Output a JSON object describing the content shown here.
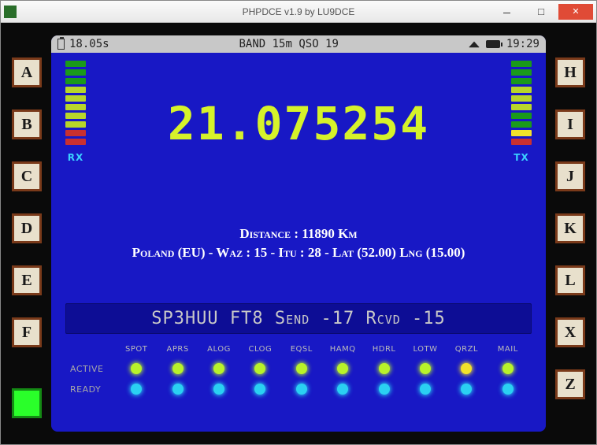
{
  "window": {
    "title": "PHPDCE v1.9 by LU9DCE"
  },
  "left_buttons": [
    "A",
    "B",
    "C",
    "D",
    "E",
    "F"
  ],
  "right_buttons": [
    "H",
    "I",
    "J",
    "K",
    "L",
    "X",
    "Z"
  ],
  "top_bar": {
    "seconds": "18.05s",
    "band_qso": "BAND 15m QSO 19",
    "clock": "19:29"
  },
  "meters": {
    "rx_label": "RX",
    "tx_label": "TX",
    "rx_colors": [
      "#1a9a1a",
      "#1a9a1a",
      "#1a9a1a",
      "#b8d62a",
      "#b8d62a",
      "#b8d62a",
      "#b8d62a",
      "#b8d62a",
      "#c93030",
      "#c93030"
    ],
    "tx_colors": [
      "#1a9a1a",
      "#1a9a1a",
      "#1a9a1a",
      "#b8d62a",
      "#b8d62a",
      "#b8d62a",
      "#1a9a1a",
      "#1a9a1a",
      "#f2e22a",
      "#c93030"
    ]
  },
  "frequency": "21.075254",
  "info": {
    "distance": "Distance : 11890 Km",
    "location": "Poland (EU) - Waz : 15 - Itu : 28 - Lat (52.00) Lng (15.00)"
  },
  "qso_bar": "SP3HUU FT8 Send -17 Rcvd -15",
  "status": {
    "columns": [
      "SPOT",
      "APRS",
      "ALOG",
      "CLOG",
      "EQSL",
      "HAMQ",
      "HDRL",
      "LOTW",
      "QRZL",
      "MAIL"
    ],
    "rows": [
      "ACTIVE",
      "READY"
    ],
    "active": [
      "green",
      "green",
      "green",
      "green",
      "green",
      "green",
      "green",
      "green",
      "yellow",
      "green"
    ],
    "ready": [
      "cyan",
      "cyan",
      "cyan",
      "cyan",
      "cyan",
      "cyan",
      "cyan",
      "cyan",
      "cyan",
      "cyan"
    ]
  }
}
